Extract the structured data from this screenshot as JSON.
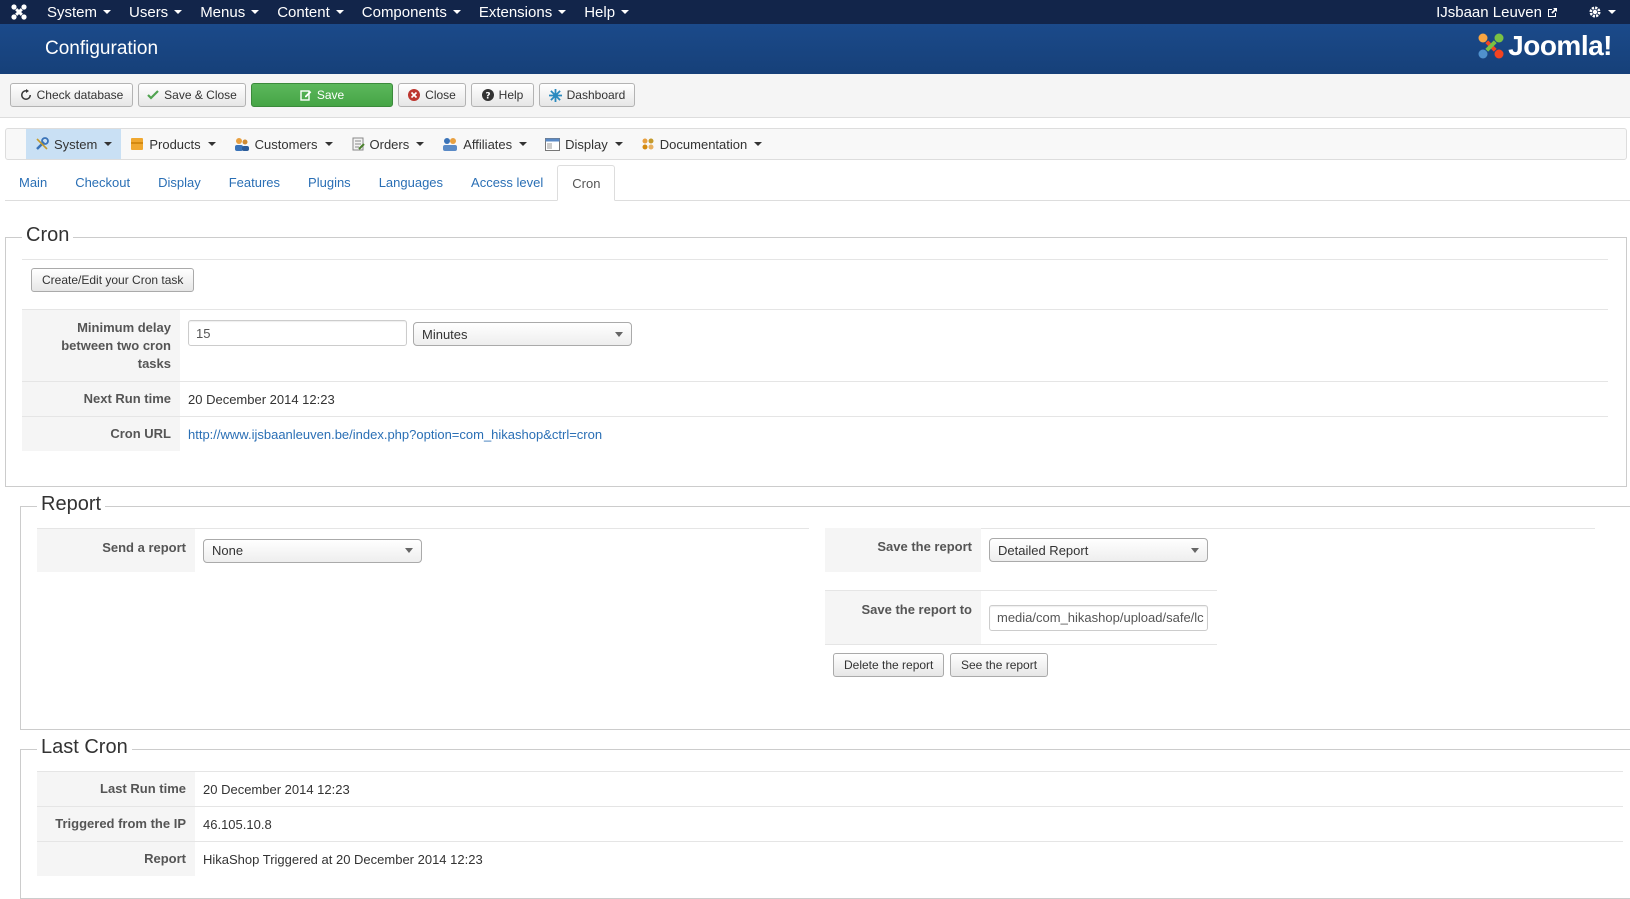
{
  "topnav": {
    "menus": [
      "System",
      "Users",
      "Menus",
      "Content",
      "Components",
      "Extensions",
      "Help"
    ],
    "user": "IJsbaan Leuven"
  },
  "header": {
    "title": "Configuration",
    "brand": "Joomla!"
  },
  "toolbar": {
    "check_database": "Check database",
    "save_close": "Save & Close",
    "save": "Save",
    "close": "Close",
    "help": "Help",
    "dashboard": "Dashboard"
  },
  "submenu": [
    "System",
    "Products",
    "Customers",
    "Orders",
    "Affiliates",
    "Display",
    "Documentation"
  ],
  "tabs": [
    "Main",
    "Checkout",
    "Display",
    "Features",
    "Plugins",
    "Languages",
    "Access level",
    "Cron"
  ],
  "cron": {
    "legend": "Cron",
    "create_button": "Create/Edit your Cron task",
    "min_delay_label": "Minimum delay between two cron tasks",
    "min_delay_value": "15",
    "min_delay_unit": "Minutes",
    "next_run_label": "Next Run time",
    "next_run_value": "20 December 2014 12:23",
    "url_label": "Cron URL",
    "url_value": "http://www.ijsbaanleuven.be/index.php?option=com_hikashop&ctrl=cron"
  },
  "report": {
    "legend": "Report",
    "send_label": "Send a report",
    "send_value": "None",
    "save_label": "Save the report",
    "save_value": "Detailed Report",
    "save_to_label": "Save the report to",
    "save_to_value": "media/com_hikashop/upload/safe/lc",
    "delete_button": "Delete the report",
    "see_button": "See the report"
  },
  "last_cron": {
    "legend": "Last Cron",
    "last_run_label": "Last Run time",
    "last_run_value": "20 December 2014 12:23",
    "ip_label": "Triggered from the IP",
    "ip_value": "46.105.10.8",
    "report_label": "Report",
    "report_value": "HikaShop Triggered at 20 December 2014 12:23"
  },
  "colors": {
    "topbar": "#12254a",
    "header": "#1b4a8a",
    "save_green": "#5bb75b",
    "link": "#2a6fb5",
    "active_menu": "#c9e0f4"
  }
}
